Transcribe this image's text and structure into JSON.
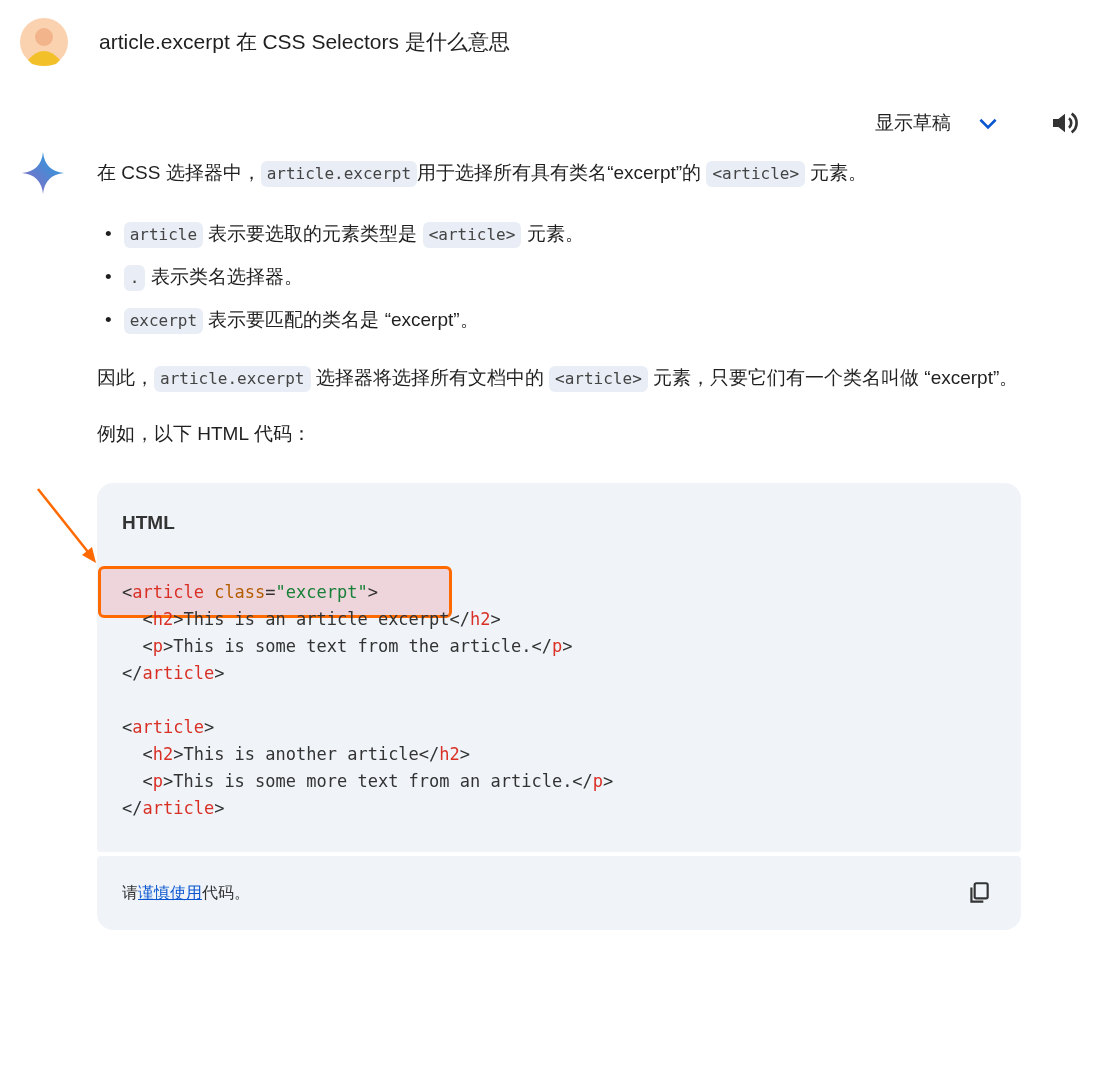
{
  "question": {
    "text": "article.excerpt 在 CSS Selectors 是什么意思"
  },
  "drafts": {
    "label": "显示草稿",
    "expanded": false
  },
  "answer": {
    "intro": [
      {
        "kind": "text",
        "text": "在 CSS 选择器中，"
      },
      {
        "kind": "code",
        "text": "article.excerpt"
      },
      {
        "kind": "text",
        "text": "用于选择所有具有类名“excerpt”的 "
      },
      {
        "kind": "code",
        "text": "<article>"
      },
      {
        "kind": "text",
        "text": " 元素。"
      }
    ],
    "bullets": [
      {
        "marker": "•",
        "segments": [
          {
            "kind": "code",
            "text": "article"
          },
          {
            "kind": "text",
            "text": " 表示要选取的元素类型是 "
          },
          {
            "kind": "code",
            "text": "<article>"
          },
          {
            "kind": "text",
            "text": " 元素。"
          }
        ]
      },
      {
        "marker": "•",
        "segments": [
          {
            "kind": "code",
            "text": "."
          },
          {
            "kind": "text",
            "text": " 表示类名选择器。"
          }
        ]
      },
      {
        "marker": "•",
        "segments": [
          {
            "kind": "code",
            "text": "excerpt"
          },
          {
            "kind": "text",
            "text": " 表示要匹配的类名是 “excerpt”。"
          }
        ]
      }
    ],
    "summary": [
      {
        "kind": "text",
        "text": "因此，"
      },
      {
        "kind": "code",
        "text": "article.excerpt"
      },
      {
        "kind": "text",
        "text": " 选择器将选择所有文档中的 "
      },
      {
        "kind": "code",
        "text": "<article>"
      },
      {
        "kind": "text",
        "text": " 元素，只要它们有一个类名叫做 “excerpt”。"
      }
    ],
    "example_lead": "例如，以下 HTML 代码：",
    "code_block": {
      "language": "HTML",
      "lines": [
        {
          "highlighted": true,
          "tokens": [
            {
              "kind": "punct",
              "text": "<"
            },
            {
              "kind": "tag",
              "text": "article"
            },
            {
              "kind": "attr",
              "text": " class"
            },
            {
              "kind": "punct",
              "text": "="
            },
            {
              "kind": "string",
              "text": "\"excerpt\""
            },
            {
              "kind": "punct",
              "text": ">"
            }
          ]
        },
        {
          "highlighted": false,
          "tokens": [
            {
              "kind": "punct",
              "text": "  <"
            },
            {
              "kind": "tag",
              "text": "h2"
            },
            {
              "kind": "punct",
              "text": ">This is an article excerpt</"
            },
            {
              "kind": "tag",
              "text": "h2"
            },
            {
              "kind": "punct",
              "text": ">"
            }
          ]
        },
        {
          "highlighted": false,
          "tokens": [
            {
              "kind": "punct",
              "text": "  <"
            },
            {
              "kind": "tag",
              "text": "p"
            },
            {
              "kind": "punct",
              "text": ">This is some text from the article.</"
            },
            {
              "kind": "tag",
              "text": "p"
            },
            {
              "kind": "punct",
              "text": ">"
            }
          ]
        },
        {
          "highlighted": false,
          "tokens": [
            {
              "kind": "punct",
              "text": "</"
            },
            {
              "kind": "tag",
              "text": "article"
            },
            {
              "kind": "punct",
              "text": ">"
            }
          ]
        },
        {
          "highlighted": false
        },
        {
          "highlighted": false,
          "tokens": [
            {
              "kind": "punct",
              "text": "<"
            },
            {
              "kind": "tag",
              "text": "article"
            },
            {
              "kind": "punct",
              "text": ">"
            }
          ]
        },
        {
          "highlighted": false,
          "tokens": [
            {
              "kind": "punct",
              "text": "  <"
            },
            {
              "kind": "tag",
              "text": "h2"
            },
            {
              "kind": "punct",
              "text": ">This is another article</"
            },
            {
              "kind": "tag",
              "text": "h2"
            },
            {
              "kind": "punct",
              "text": ">"
            }
          ]
        },
        {
          "highlighted": false,
          "tokens": [
            {
              "kind": "punct",
              "text": "  <"
            },
            {
              "kind": "tag",
              "text": "p"
            },
            {
              "kind": "punct",
              "text": ">This is some more text from an article.</"
            },
            {
              "kind": "tag",
              "text": "p"
            },
            {
              "kind": "punct",
              "text": ">"
            }
          ]
        },
        {
          "highlighted": false,
          "tokens": [
            {
              "kind": "punct",
              "text": "</"
            },
            {
              "kind": "tag",
              "text": "article"
            },
            {
              "kind": "punct",
              "text": ">"
            }
          ]
        }
      ]
    },
    "code_footer": [
      {
        "kind": "text",
        "text": "请"
      },
      {
        "kind": "link",
        "text": "谨慎使用"
      },
      {
        "kind": "text",
        "text": "代码。"
      }
    ]
  }
}
